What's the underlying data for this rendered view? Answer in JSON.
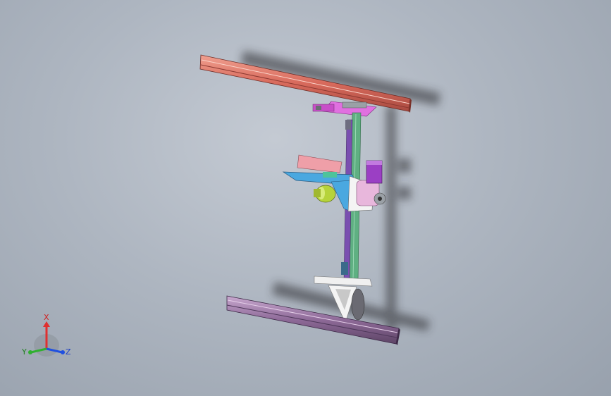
{
  "triad": {
    "x_label": "X",
    "y_label": "Y",
    "z_label": "Z"
  },
  "colors": {
    "background": "#aeb6c1",
    "rail_top": "#e0786a",
    "rail_bottom": "#9a76a2",
    "column": "#5fb082",
    "bracket_blue": "#4aa8e0",
    "bracket_pink": "#e99aa5",
    "motor_purple": "#9b3fc4",
    "gearbox_pink": "#e8b7dc",
    "clamp_green": "#b6d33b",
    "caster_white": "#f0f0f0",
    "axis_x": "#e03030",
    "axis_y": "#30b030",
    "axis_z": "#2050e0"
  }
}
